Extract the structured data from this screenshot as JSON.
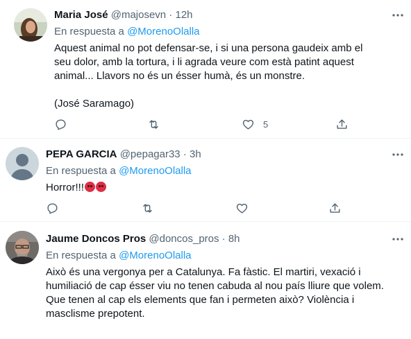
{
  "tweets": [
    {
      "name": "Maria José",
      "handle": "@majosevn · 12h",
      "reply_prefix": "En respuesta a",
      "reply_to": "@MorenoOlalla",
      "text": "Aquest animal no pot defensar-se, i si una persona gaudeix amb el seu dolor, amb la tortura, i li agrada veure com està patint aquest animal... Llavors no és un ésser humà, és un monstre.\n\n(José Saramago)",
      "like_count": "5"
    },
    {
      "name": "PEPA GARCIA",
      "handle": "@pepagar33 · 3h",
      "reply_prefix": "En respuesta a",
      "reply_to": "@MorenoOlalla",
      "text": "Horror!!!",
      "emojis": [
        "angry-face-icon",
        "angry-face-icon"
      ]
    },
    {
      "name": "Jaume Doncos Pros",
      "handle": "@doncos_pros · 8h",
      "reply_prefix": "En respuesta a",
      "reply_to": "@MorenoOlalla",
      "text": "Això és una vergonya per a Catalunya. Fa fàstic. El martiri, vexació i humiliació de cap ésser viu no tenen cabuda al nou país lliure que volem. Que tenen al cap els elements que fan i permeten això? Violència i masclisme prepotent."
    }
  ],
  "colors": {
    "accent": "#1d9bf0",
    "secondary": "#536471",
    "text": "#0f1419"
  }
}
